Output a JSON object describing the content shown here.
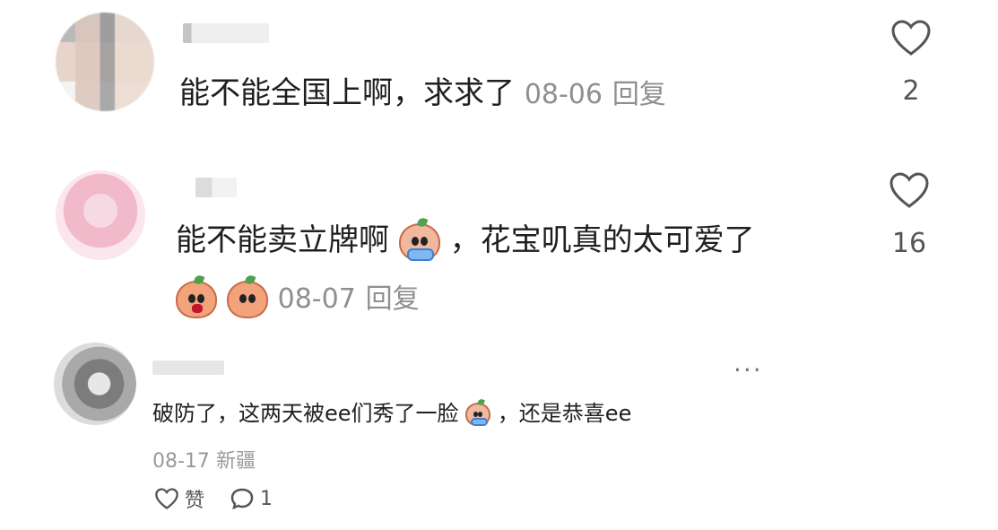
{
  "comments": [
    {
      "text": "能不能全国上啊，求求了",
      "date": "08-06",
      "reply": "回复",
      "likes": "2"
    },
    {
      "text_part1": "能不能卖立牌啊",
      "text_part2": "，花宝叽真的太可爱了",
      "date": "08-07",
      "reply": "回复",
      "likes": "16",
      "emojis": [
        "crying-emoji",
        "shocked-emoji",
        "begging-emoji"
      ]
    },
    {
      "text_part1": "破防了，这两天被ee们秀了一脸",
      "text_part2": "，还是恭喜ee",
      "date": "08-17",
      "location": "新疆",
      "like_label": "赞",
      "reply_count": "1",
      "more_label": "···",
      "emojis": [
        "crying-emoji"
      ]
    }
  ],
  "colors": {
    "text": "#1f1f1f",
    "meta": "#8f8f8f",
    "icon": "#555555"
  }
}
